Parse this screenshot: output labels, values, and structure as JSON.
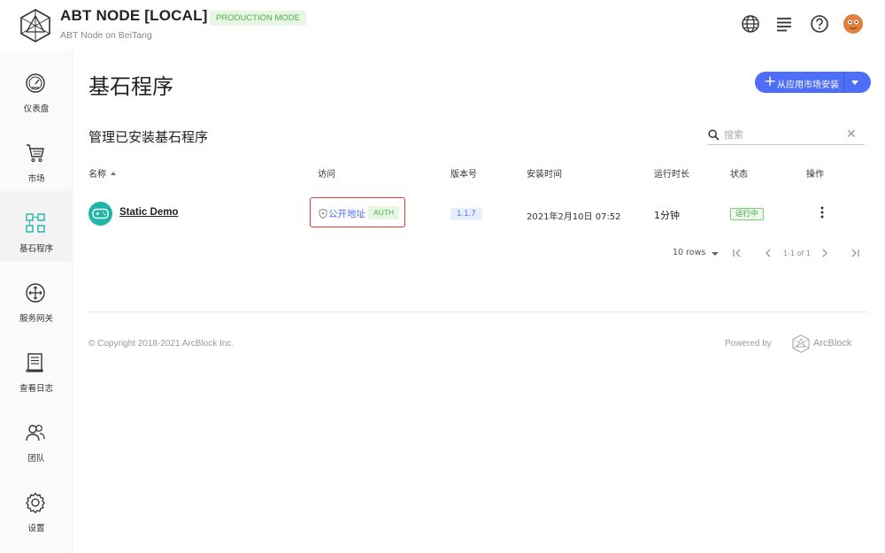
{
  "header": {
    "title": "ABT NODE [LOCAL]",
    "mode_badge": "PRODUCTION MODE",
    "subtitle": "ABT Node on BeiTang",
    "icons": [
      "globe-icon",
      "list-icon",
      "help-icon"
    ]
  },
  "sidebar": {
    "items": [
      {
        "label": "仪表盘",
        "icon": "dashboard-icon",
        "active": false
      },
      {
        "label": "市场",
        "icon": "cart-icon",
        "active": false
      },
      {
        "label": "基石程序",
        "icon": "blocklets-icon",
        "active": true
      },
      {
        "label": "服务网关",
        "icon": "gateway-icon",
        "active": false
      },
      {
        "label": "查看日志",
        "icon": "log-icon",
        "active": false
      },
      {
        "label": "团队",
        "icon": "team-icon",
        "active": false
      },
      {
        "label": "设置",
        "icon": "gear-icon",
        "active": false
      }
    ]
  },
  "main": {
    "page_title": "基石程序",
    "install_button": "从应用市场安装",
    "section_title": "管理已安装基石程序",
    "search": {
      "placeholder": "搜索",
      "value": ""
    },
    "table": {
      "headers": [
        "名称",
        "访问",
        "版本号",
        "安装时间",
        "运行时长",
        "状态",
        "操作"
      ],
      "rows": [
        {
          "name": "Static Demo",
          "access_label": "公开地址",
          "access_badge": "AUTH",
          "version": "1.1.7",
          "installed_at": "2021年2月10日 07:52",
          "uptime": "1分钟",
          "status": "运行中"
        }
      ]
    },
    "pagination": {
      "rows_per_page": "10 rows",
      "range": "1-1 of 1"
    }
  },
  "footer": {
    "copyright": "© Copyright 2018-2021  ArcBlock Inc.",
    "powered_by": "Powered by",
    "brand": "ArcBlock"
  },
  "colors": {
    "accent": "#4f6ef7",
    "success": "#4caf50",
    "highlight_border": "#e53935"
  }
}
